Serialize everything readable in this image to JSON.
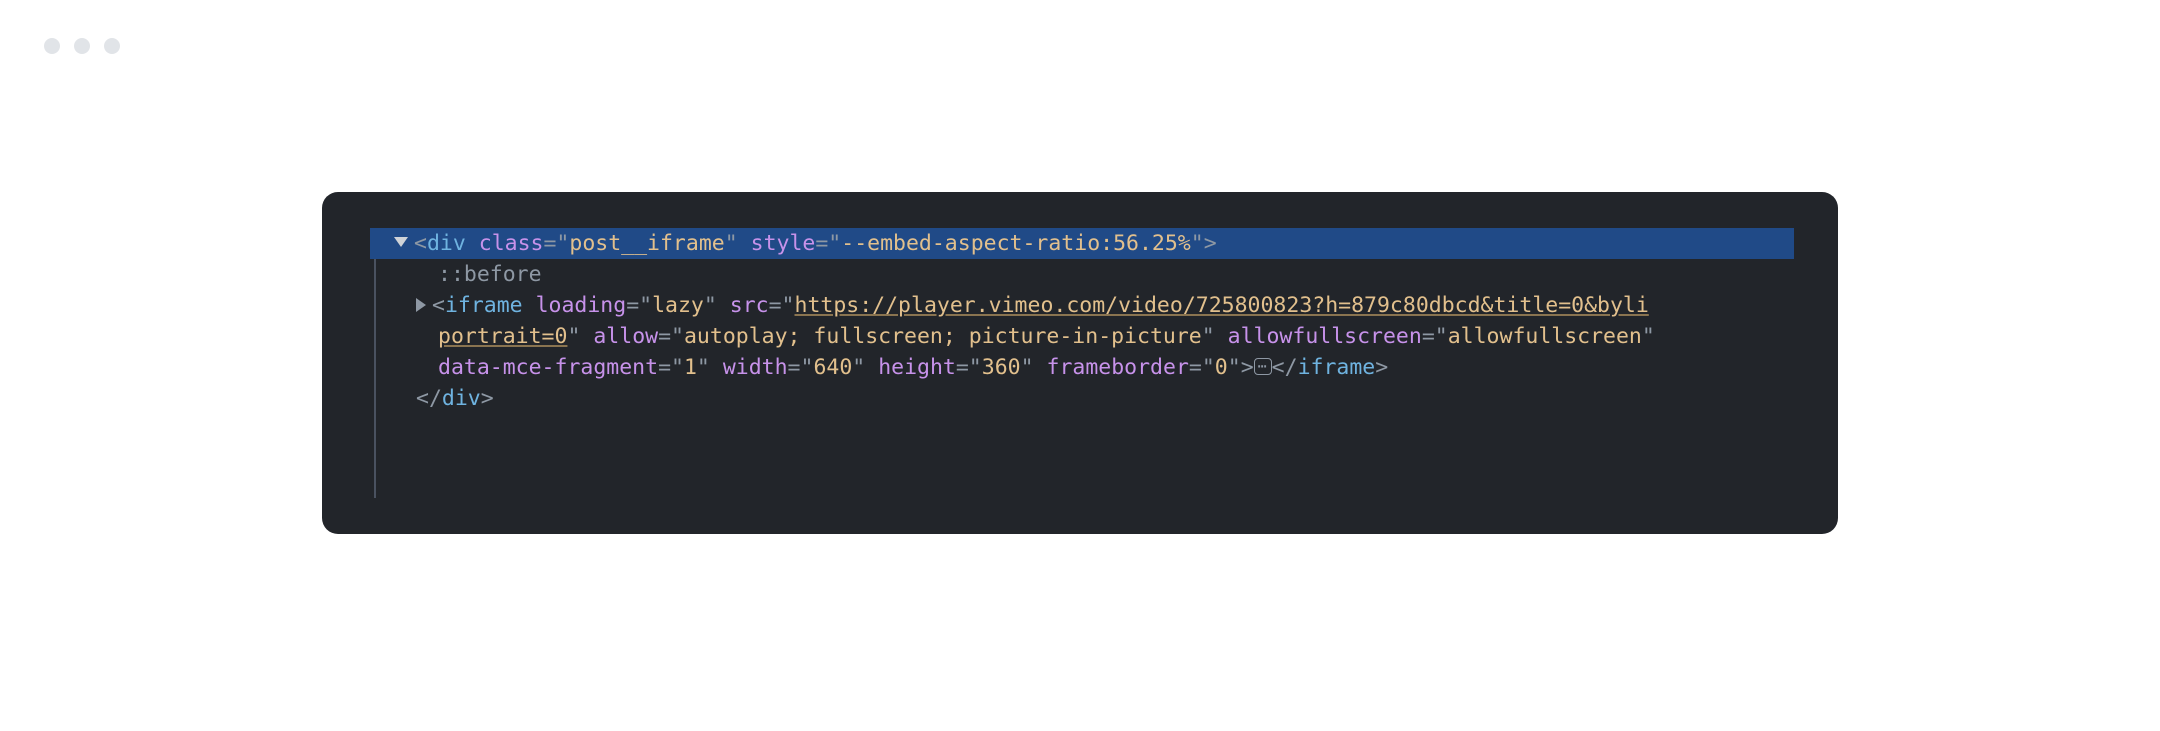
{
  "windowDots": 3,
  "code": {
    "line1": {
      "open": "<",
      "tag": "div",
      "sp": " ",
      "attr1": "class",
      "eq": "=\"",
      "val1": "post__iframe",
      "q": "\"",
      "attr2": "style",
      "val2": "--embed-aspect-ratio:56.25%",
      "close": ">"
    },
    "line2": {
      "pseudo": "::before"
    },
    "line3": {
      "open": "<",
      "tag": "iframe",
      "attrs": {
        "loading": "lazy",
        "src_a": "https://player.vimeo.com/video/725800823?h=879c80dbcd&title=0&byli",
        "src_b": "portrait=0",
        "allow": "autoplay; fullscreen; picture-in-picture",
        "allowfullscreen": "allowfullscreen",
        "data_mce_fragment": "1",
        "width": "640",
        "height": "360",
        "frameborder": "0"
      },
      "ellipsis": "⋯",
      "closeTag": "iframe"
    },
    "line4": {
      "open": "</",
      "tag": "div",
      "close": ">"
    },
    "labels": {
      "src": "src",
      "loading": "loading",
      "allow": "allow",
      "allowfullscreen": "allowfullscreen",
      "data_mce_fragment": "data-mce-fragment",
      "width": "width",
      "height": "height",
      "frameborder": "frameborder"
    }
  }
}
